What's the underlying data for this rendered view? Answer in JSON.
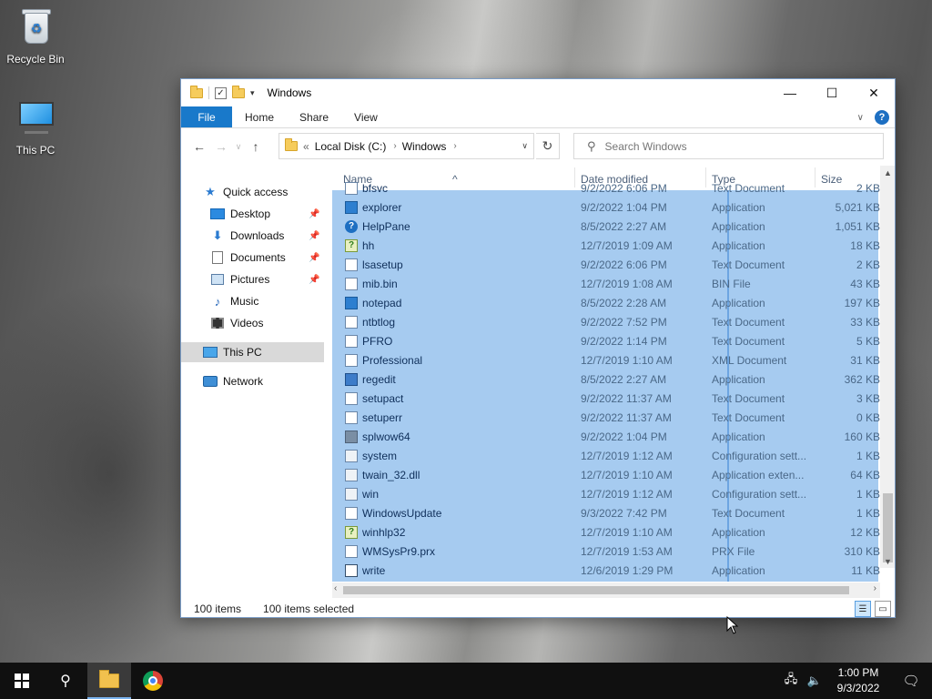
{
  "desktop": {
    "icons": [
      {
        "label": "Recycle Bin",
        "icon": "recycle-bin-icon"
      },
      {
        "label": "This PC",
        "icon": "computer-icon"
      }
    ]
  },
  "window": {
    "title": "Windows",
    "ribbon_tabs": [
      "File",
      "Home",
      "Share",
      "View"
    ],
    "address": {
      "root": "Local Disk (C:)",
      "folder": "Windows",
      "overflow": "«"
    },
    "search_placeholder": "Search Windows",
    "columns": {
      "name": "Name",
      "date": "Date modified",
      "type": "Type",
      "size": "Size"
    },
    "accent": "#1979ca",
    "selection_color": "#a6cbf0"
  },
  "navpane": {
    "items": [
      {
        "label": "Quick access",
        "icon": "star-icon"
      },
      {
        "label": "Desktop",
        "icon": "desktop-icon",
        "pinned": true
      },
      {
        "label": "Downloads",
        "icon": "download-arrow-icon",
        "pinned": true
      },
      {
        "label": "Documents",
        "icon": "document-icon",
        "pinned": true
      },
      {
        "label": "Pictures",
        "icon": "pictures-icon",
        "pinned": true
      },
      {
        "label": "Music",
        "icon": "music-note-icon"
      },
      {
        "label": "Videos",
        "icon": "video-icon"
      },
      {
        "label": "This PC",
        "icon": "computer-icon",
        "selected": true
      },
      {
        "label": "Network",
        "icon": "network-icon"
      }
    ]
  },
  "files": [
    {
      "name": "bfsvc",
      "date": "9/2/2022 6:06 PM",
      "type": "Text Document",
      "size": "2 KB",
      "icon": "doc"
    },
    {
      "name": "explorer",
      "date": "9/2/2022 1:04 PM",
      "type": "Application",
      "size": "5,021 KB",
      "icon": "app"
    },
    {
      "name": "HelpPane",
      "date": "8/5/2022 2:27 AM",
      "type": "Application",
      "size": "1,051 KB",
      "icon": "help"
    },
    {
      "name": "hh",
      "date": "12/7/2019 1:09 AM",
      "type": "Application",
      "size": "18 KB",
      "icon": "q"
    },
    {
      "name": "lsasetup",
      "date": "9/2/2022 6:06 PM",
      "type": "Text Document",
      "size": "2 KB",
      "icon": "doc"
    },
    {
      "name": "mib.bin",
      "date": "12/7/2019 1:08 AM",
      "type": "BIN File",
      "size": "43 KB",
      "icon": "doc"
    },
    {
      "name": "notepad",
      "date": "8/5/2022 2:28 AM",
      "type": "Application",
      "size": "197 KB",
      "icon": "app"
    },
    {
      "name": "ntbtlog",
      "date": "9/2/2022 7:52 PM",
      "type": "Text Document",
      "size": "33 KB",
      "icon": "doc"
    },
    {
      "name": "PFRO",
      "date": "9/2/2022 1:14 PM",
      "type": "Text Document",
      "size": "5 KB",
      "icon": "doc"
    },
    {
      "name": "Professional",
      "date": "12/7/2019 1:10 AM",
      "type": "XML Document",
      "size": "31 KB",
      "icon": "doc"
    },
    {
      "name": "regedit",
      "date": "8/5/2022 2:27 AM",
      "type": "Application",
      "size": "362 KB",
      "icon": "reg"
    },
    {
      "name": "setupact",
      "date": "9/2/2022 11:37 AM",
      "type": "Text Document",
      "size": "3 KB",
      "icon": "doc"
    },
    {
      "name": "setuperr",
      "date": "9/2/2022 11:37 AM",
      "type": "Text Document",
      "size": "0 KB",
      "icon": "doc"
    },
    {
      "name": "splwow64",
      "date": "9/2/2022 1:04 PM",
      "type": "Application",
      "size": "160 KB",
      "icon": "print"
    },
    {
      "name": "system",
      "date": "12/7/2019 1:12 AM",
      "type": "Configuration sett...",
      "size": "1 KB",
      "icon": "sys"
    },
    {
      "name": "twain_32.dll",
      "date": "12/7/2019 1:10 AM",
      "type": "Application exten...",
      "size": "64 KB",
      "icon": "sys"
    },
    {
      "name": "win",
      "date": "12/7/2019 1:12 AM",
      "type": "Configuration sett...",
      "size": "1 KB",
      "icon": "sys"
    },
    {
      "name": "WindowsUpdate",
      "date": "9/3/2022 7:42 PM",
      "type": "Text Document",
      "size": "1 KB",
      "icon": "doc"
    },
    {
      "name": "winhlp32",
      "date": "12/7/2019 1:10 AM",
      "type": "Application",
      "size": "12 KB",
      "icon": "q"
    },
    {
      "name": "WMSysPr9.prx",
      "date": "12/7/2019 1:53 AM",
      "type": "PRX File",
      "size": "310 KB",
      "icon": "doc"
    },
    {
      "name": "write",
      "date": "12/6/2019 1:29 PM",
      "type": "Application",
      "size": "11 KB",
      "icon": "pen"
    }
  ],
  "status": {
    "count": "100 items",
    "selected": "100 items selected"
  },
  "taskbar": {
    "time": "1:00 PM",
    "date": "9/3/2022",
    "apps": [
      "start-icon",
      "search-icon",
      "file-explorer-icon",
      "chrome-icon"
    ]
  }
}
